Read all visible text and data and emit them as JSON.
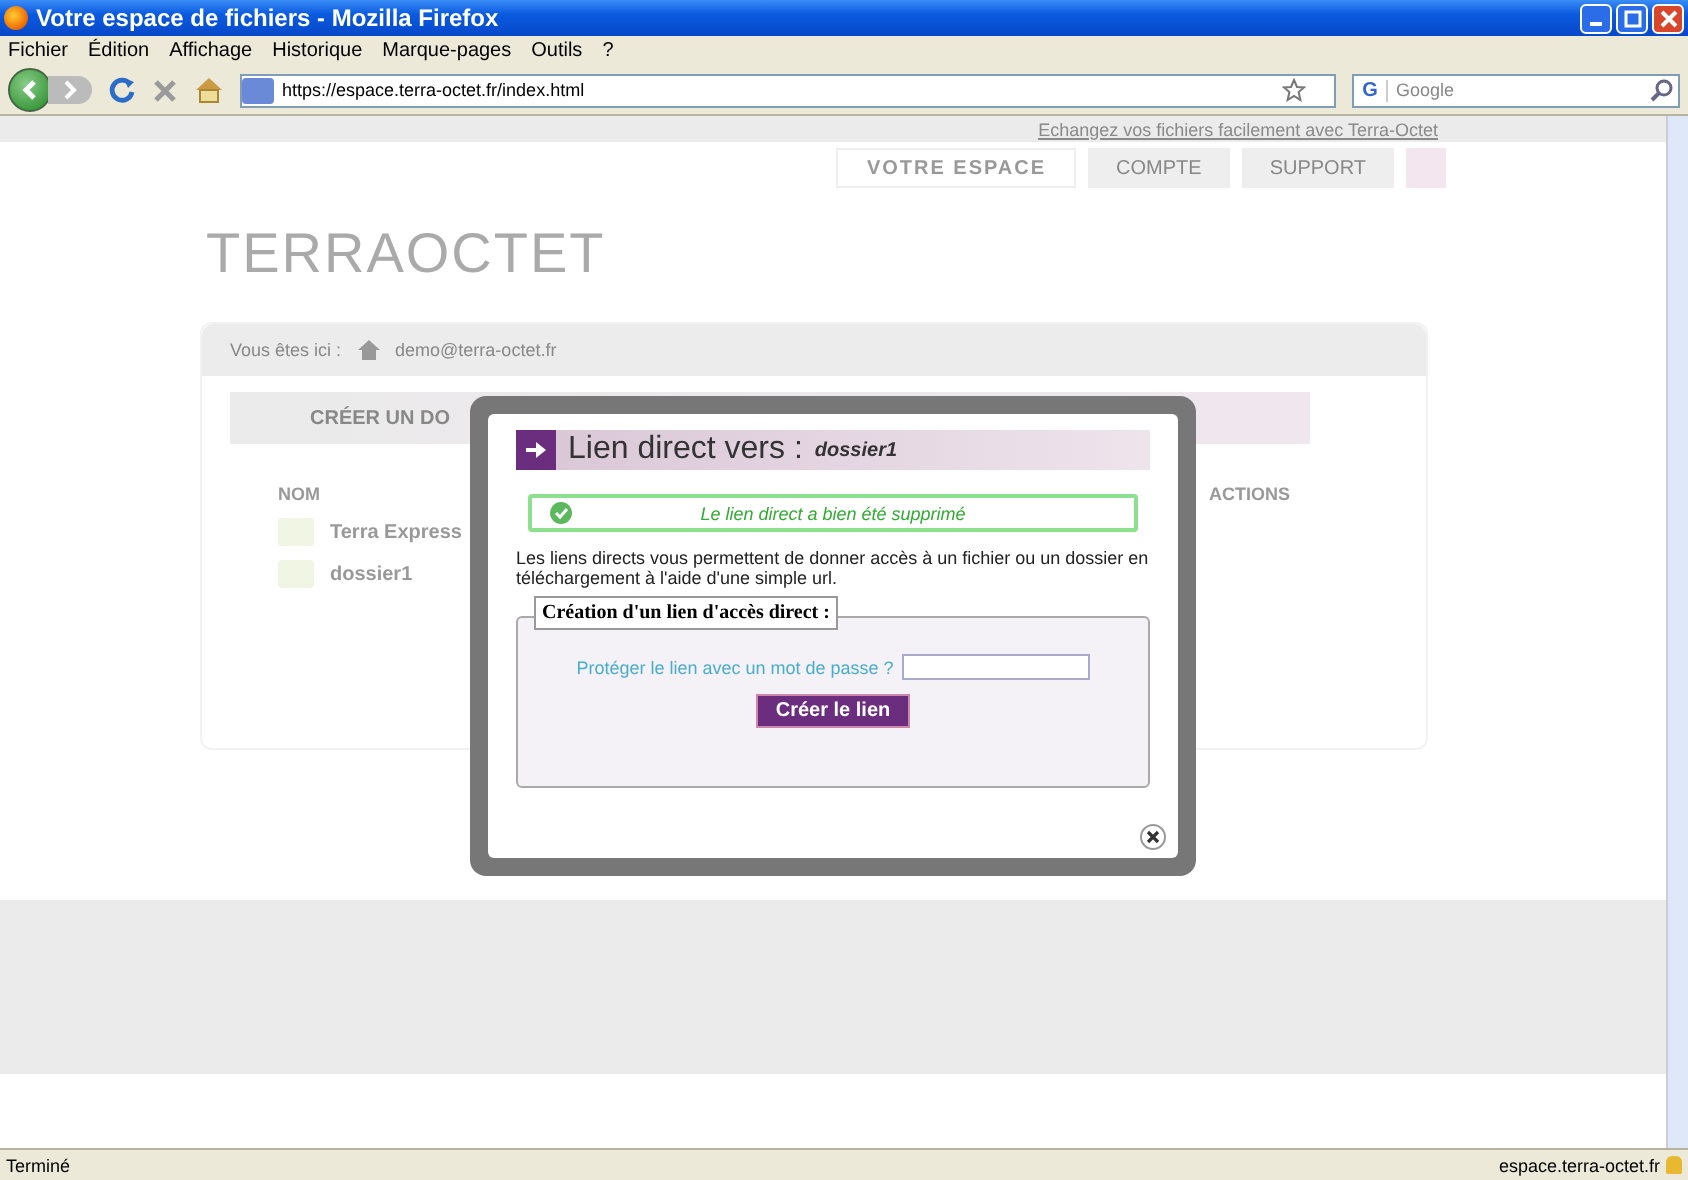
{
  "window": {
    "title": "Votre espace de fichiers - Mozilla Firefox"
  },
  "menu": [
    "Fichier",
    "Édition",
    "Affichage",
    "Historique",
    "Marque-pages",
    "Outils",
    "?"
  ],
  "toolbar": {
    "url": "https://espace.terra-octet.fr/index.html",
    "search_engine": "G",
    "search_placeholder": "Google"
  },
  "page": {
    "top_link": "Echangez vos fichiers facilement avec Terra-Octet",
    "nav": [
      {
        "label": "VOTRE ESPACE",
        "selected": true
      },
      {
        "label": "COMPTE",
        "selected": false
      },
      {
        "label": "SUPPORT",
        "selected": false
      }
    ],
    "logo": "TERRAOCTET",
    "breadcrumb_label": "Vous êtes ici :",
    "breadcrumb": "demo@terra-octet.fr",
    "create_folder": "CRÉER UN DO",
    "columns": [
      "NOM",
      "ACTIONS"
    ],
    "rows": [
      "Terra Express",
      "dossier1"
    ]
  },
  "dialog": {
    "title": "Lien direct vers :",
    "target": "dossier1",
    "message": "Le lien direct a bien été supprimé",
    "description": "Les liens directs vous permettent de donner accès à un fichier ou un dossier en téléchargement à l'aide d'une simple url.",
    "fieldset": "Création d'un lien d'accès direct :",
    "password_label": "Protéger le lien avec un mot de passe ?",
    "button": "Créer le lien"
  },
  "status_bar": {
    "text": "Terminé",
    "domain": "espace.terra-octet.fr"
  }
}
